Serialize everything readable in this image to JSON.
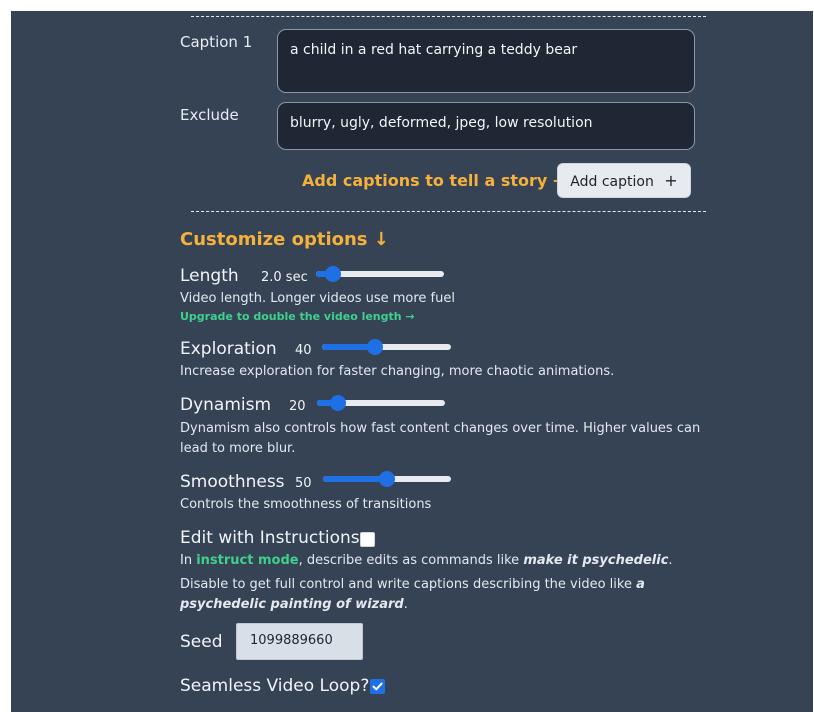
{
  "captions": {
    "caption1_label": "Caption 1",
    "caption1_value": "a child in a red hat carrying a teddy bear",
    "exclude_label": "Exclude",
    "exclude_value": "blurry, ugly, deformed, jpeg, low resolution",
    "add_story_text": "Add captions to tell a story →",
    "add_caption_label": "Add caption",
    "add_caption_icon": "+"
  },
  "options": {
    "heading": "Customize options ↓",
    "length": {
      "label": "Length",
      "value": "2.0 sec",
      "fraction": 0.08,
      "desc": "Video length. Longer videos use more fuel",
      "upgrade": "Upgrade to double the video length →"
    },
    "exploration": {
      "label": "Exploration",
      "value": "40",
      "fraction": 0.4,
      "desc": "Increase exploration for faster changing, more chaotic animations."
    },
    "dynamism": {
      "label": "Dynamism",
      "value": "20",
      "fraction": 0.12,
      "desc_line1": "Dynamism also controls how fast content changes over time. Higher values can",
      "desc_line2": "lead to more blur."
    },
    "smoothness": {
      "label": "Smoothness",
      "value": "50",
      "fraction": 0.5,
      "desc": "Controls the smoothness of transitions"
    },
    "instructions": {
      "label": "Edit with Instructions",
      "checked": false,
      "line1_prefix": "In ",
      "line1_link": "instruct mode",
      "line1_mid": ", describe edits as commands like ",
      "line1_em": "make it psychedelic",
      "line1_end": ".",
      "line2_text": "Disable to get full control and write captions describing the video like ",
      "line2_em_a": "a",
      "line3_em": "psychedelic painting of wizard",
      "line3_end": "."
    },
    "seed": {
      "label": "Seed",
      "value": "1099889660"
    },
    "loop": {
      "label": "Seamless Video Loop?",
      "checked": true
    }
  },
  "colors": {
    "panel": "#354355",
    "accent": "#f5b13b",
    "slider": "#1f6fe5",
    "link": "#3fd08c"
  }
}
